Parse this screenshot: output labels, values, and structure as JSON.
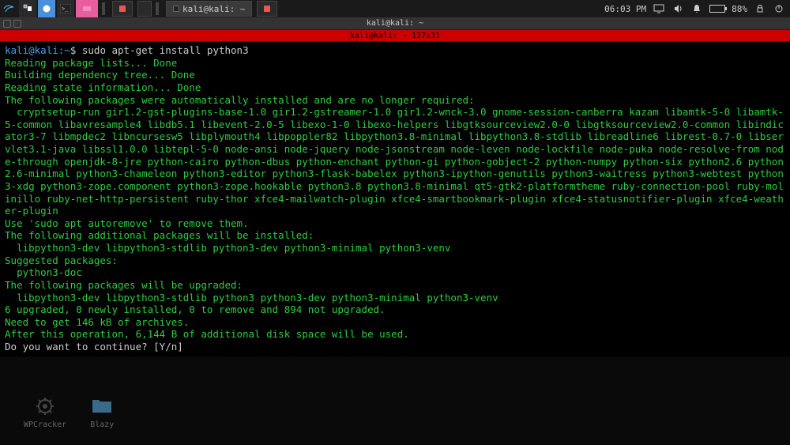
{
  "topbar": {
    "task_label": "kali@kali: ~",
    "clock": "06:03 PM",
    "battery": "88%"
  },
  "window": {
    "title": "kali@kali: ~",
    "tab": "kali@kali: ~ 127x31"
  },
  "terminal": {
    "prompt_user": "kali",
    "prompt_at": "@",
    "prompt_host": "kali",
    "prompt_path": ":~",
    "prompt_sym": "$ ",
    "command": "sudo apt-get install python3",
    "lines": [
      "Reading package lists... Done",
      "Building dependency tree... Done",
      "Reading state information... Done"
    ],
    "auto_header": "The following packages were automatically installed and are no longer required:",
    "auto_packages": "  cryptsetup-run gir1.2-gst-plugins-base-1.0 gir1.2-gstreamer-1.0 gir1.2-wnck-3.0 gnome-session-canberra kazam libamtk-5-0 libamtk-5-common libavresample4 libdb5.1 libevent-2.0-5 libexo-1-0 libexo-helpers libgtksourceview2.0-0 libgtksourceview2.0-common libindicator3-7 libmpdec2 libncursesw5 libplymouth4 libpoppler82 libpython3.8-minimal libpython3.8-stdlib libreadline6 librest-0.7-0 libservlet3.1-java libssl1.0.0 libtepl-5-0 node-ansi node-jquery node-jsonstream node-leven node-lockfile node-puka node-resolve-from node-through openjdk-8-jre python-cairo python-dbus python-enchant python-gi python-gobject-2 python-numpy python-six python2.6 python2.6-minimal python3-chameleon python3-editor python3-flask-babelex python3-ipython-genutils python3-waitress python3-webtest python3-xdg python3-zope.component python3-zope.hookable python3.8 python3.8-minimal qt5-gtk2-platformtheme ruby-connection-pool ruby-molinillo ruby-net-http-persistent ruby-thor xfce4-mailwatch-plugin xfce4-smartbookmark-plugin xfce4-statusnotifier-plugin xfce4-weather-plugin",
    "auto_hint": "Use 'sudo apt autoremove' to remove them.",
    "additional_header": "The following additional packages will be installed:",
    "additional_packages": "  libpython3-dev libpython3-stdlib python3-dev python3-minimal python3-venv",
    "suggested_header": "Suggested packages:",
    "suggested_packages": "  python3-doc",
    "upgraded_header": "The following packages will be upgraded:",
    "upgraded_packages": "  libpython3-dev libpython3-stdlib python3 python3-dev python3-minimal python3-venv",
    "summary": "6 upgraded, 0 newly installed, 0 to remove and 894 not upgraded.",
    "need": "Need to get 146 kB of archives.",
    "after": "After this operation, 6,144 B of additional disk space will be used.",
    "prompt_continue": "Do you want to continue? [Y/n] "
  },
  "desktop": {
    "icon1": "WPCracker",
    "icon2": "Blazy"
  }
}
